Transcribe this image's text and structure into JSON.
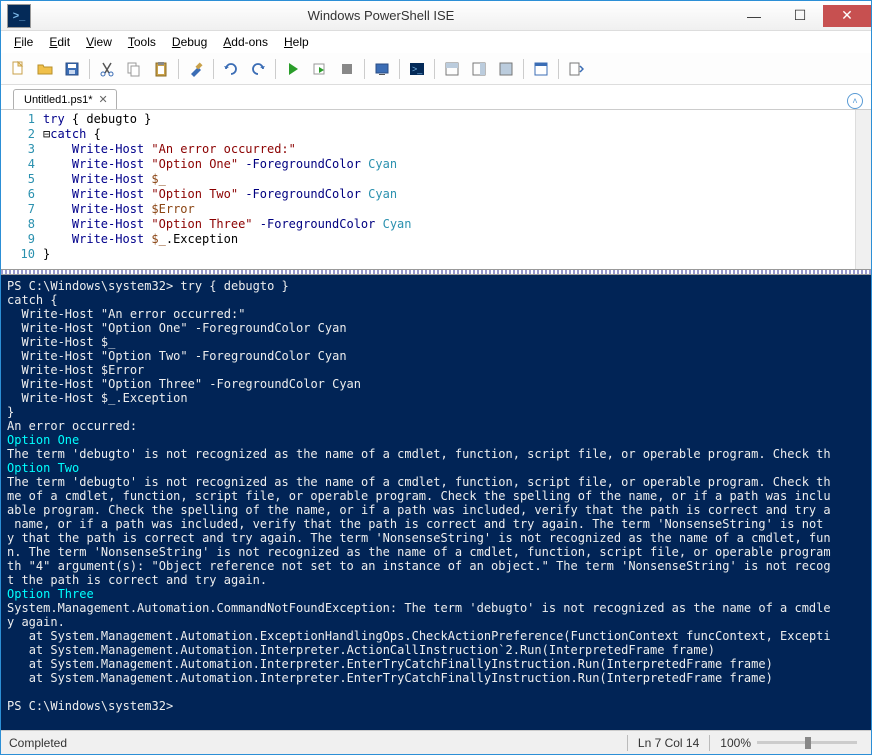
{
  "window": {
    "title": "Windows PowerShell ISE"
  },
  "menu": {
    "file": "File",
    "edit": "Edit",
    "view": "View",
    "tools": "Tools",
    "debug": "Debug",
    "addons": "Add-ons",
    "help": "Help"
  },
  "tab": {
    "label": "Untitled1.ps1*"
  },
  "editor": {
    "lines": [
      {
        "n": "1",
        "html": "<span class='kw'>try</span> { debugto }"
      },
      {
        "n": "2",
        "html": "⊟<span class='kw'>catch</span> {"
      },
      {
        "n": "3",
        "html": "    <span class='kw'>Write-Host</span> <span class='str'>\"An error occurred:\"</span>"
      },
      {
        "n": "4",
        "html": "    <span class='kw'>Write-Host</span> <span class='str'>\"Option One\"</span> <span class='param'>-ForegroundColor</span> <span class='typ'>Cyan</span>"
      },
      {
        "n": "5",
        "html": "    <span class='kw'>Write-Host</span> <span class='var'>$_</span>"
      },
      {
        "n": "6",
        "html": "    <span class='kw'>Write-Host</span> <span class='str'>\"Option Two\"</span> <span class='param'>-ForegroundColor</span> <span class='typ'>Cyan</span>"
      },
      {
        "n": "7",
        "html": "    <span class='kw'>Write-Host</span> <span class='var'>$Error</span>"
      },
      {
        "n": "8",
        "html": "    <span class='kw'>Write-Host</span> <span class='str'>\"Option Three\"</span> <span class='param'>-ForegroundColor</span> <span class='typ'>Cyan</span>"
      },
      {
        "n": "9",
        "html": "    <span class='kw'>Write-Host</span> <span class='var'>$_</span>.Exception"
      },
      {
        "n": "10",
        "html": "}"
      }
    ]
  },
  "console": {
    "prompt1": "PS C:\\Windows\\system32> try { debugto }",
    "input": [
      "catch {",
      "  Write-Host \"An error occurred:\"",
      "  Write-Host \"Option One\" -ForegroundColor Cyan",
      "  Write-Host $_",
      "  Write-Host \"Option Two\" -ForegroundColor Cyan",
      "  Write-Host $Error",
      "  Write-Host \"Option Three\" -ForegroundColor Cyan",
      "  Write-Host $_.Exception",
      "}"
    ],
    "out_err": "An error occurred:",
    "opt1": "Option One",
    "opt1_text": "The term 'debugto' is not recognized as the name of a cmdlet, function, script file, or operable program. Check th",
    "opt2": "Option Two",
    "opt2_text": "The term 'debugto' is not recognized as the name of a cmdlet, function, script file, or operable program. Check th\nme of a cmdlet, function, script file, or operable program. Check the spelling of the name, or if a path was inclu\nable program. Check the spelling of the name, or if a path was included, verify that the path is correct and try a\n name, or if a path was included, verify that the path is correct and try again. The term 'NonsenseString' is not \ny that the path is correct and try again. The term 'NonsenseString' is not recognized as the name of a cmdlet, fun\nn. The term 'NonsenseString' is not recognized as the name of a cmdlet, function, script file, or operable program\nth \"4\" argument(s): \"Object reference not set to an instance of an object.\" The term 'NonsenseString' is not recog\nt the path is correct and try again.",
    "opt3": "Option Three",
    "opt3_text": "System.Management.Automation.CommandNotFoundException: The term 'debugto' is not recognized as the name of a cmdle\ny again.\n   at System.Management.Automation.ExceptionHandlingOps.CheckActionPreference(FunctionContext funcContext, Excepti\n   at System.Management.Automation.Interpreter.ActionCallInstruction`2.Run(InterpretedFrame frame)\n   at System.Management.Automation.Interpreter.EnterTryCatchFinallyInstruction.Run(InterpretedFrame frame)\n   at System.Management.Automation.Interpreter.EnterTryCatchFinallyInstruction.Run(InterpretedFrame frame)",
    "prompt2": "PS C:\\Windows\\system32>"
  },
  "status": {
    "left": "Completed",
    "pos": "Ln 7  Col 14",
    "zoom": "100%"
  }
}
